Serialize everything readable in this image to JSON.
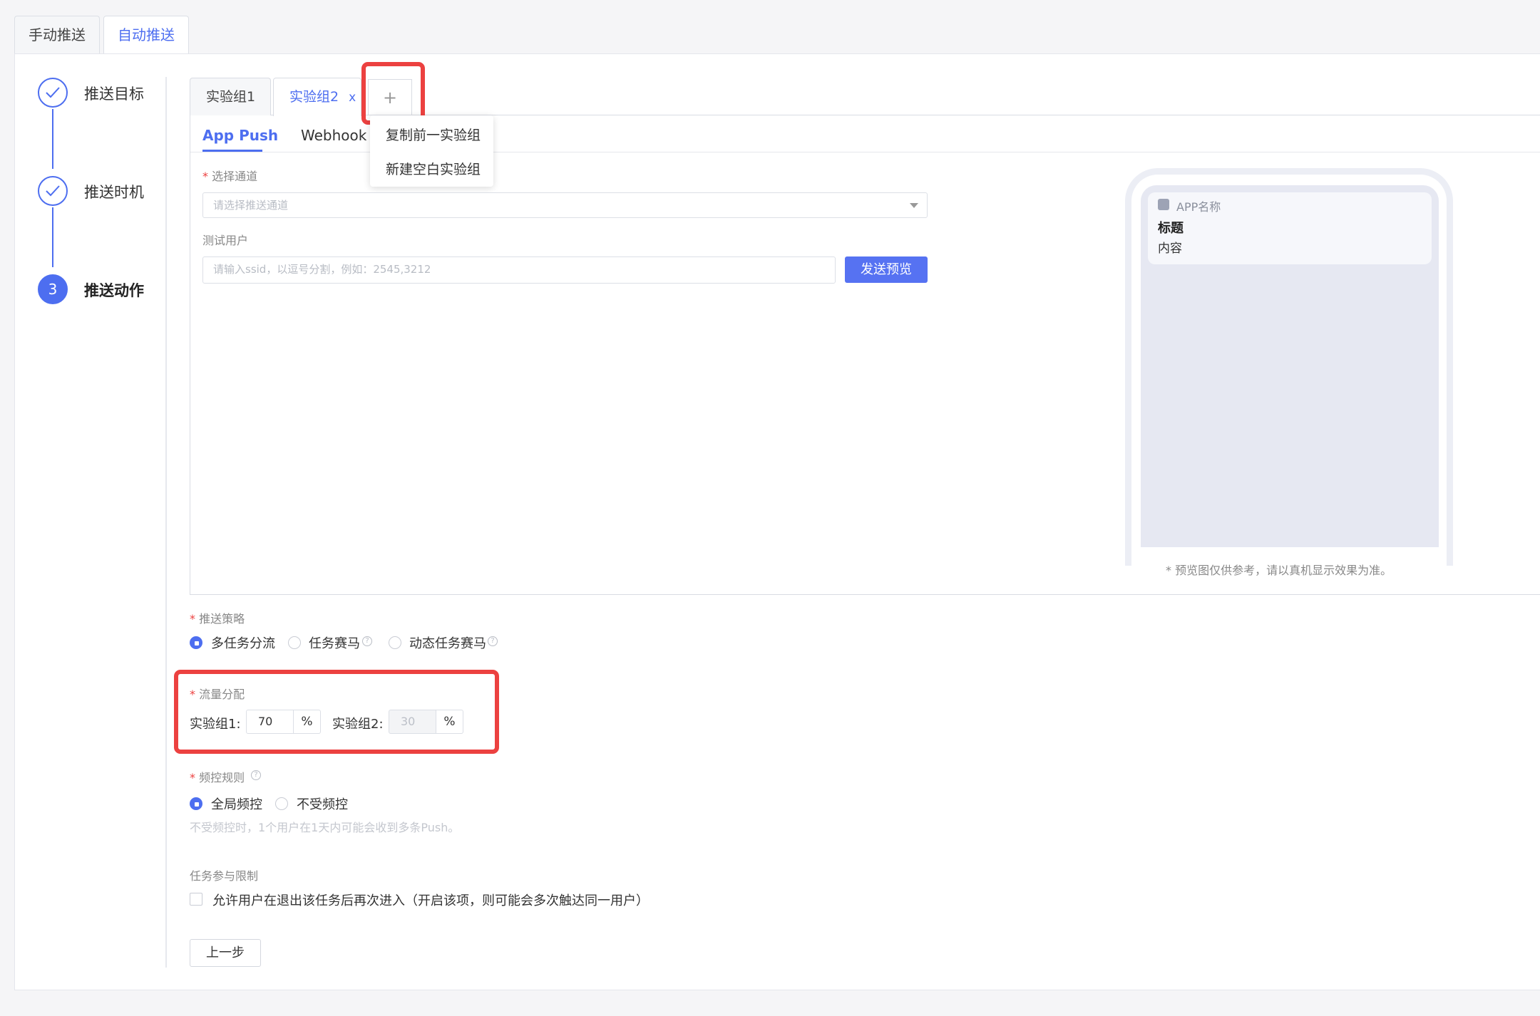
{
  "top_tabs": [
    "手动推送",
    "自动推送"
  ],
  "steps": [
    {
      "label": "推送目标",
      "state": "done"
    },
    {
      "label": "推送时机",
      "state": "done"
    },
    {
      "label": "推送动作",
      "state": "current",
      "number": "3"
    }
  ],
  "experiment_tabs": {
    "tabs": [
      "实验组1",
      "实验组2"
    ],
    "close_glyph": "x",
    "add_glyph": "+",
    "dropdown": [
      "复制前一实验组",
      "新建空白实验组"
    ]
  },
  "channel_tabs": [
    "App Push",
    "Webhook"
  ],
  "form": {
    "channel_label": "选择通道",
    "channel_placeholder": "请选择推送通道",
    "test_user_label": "测试用户",
    "test_user_placeholder": "请输入ssid，以逗号分割，例如：2545,3212",
    "send_preview_button": "发送预览",
    "required_mark": "*"
  },
  "preview": {
    "app_name": "APP名称",
    "title": "标题",
    "content": "内容",
    "note": "* 预览图仅供参考，请以真机显示效果为准。"
  },
  "strategy": {
    "label": "推送策略",
    "options": [
      "多任务分流",
      "任务赛马",
      "动态任务赛马"
    ],
    "selected": "多任务分流",
    "help_glyph": "?"
  },
  "traffic": {
    "label": "流量分配",
    "group1_label": "实验组1:",
    "group1_value": "70",
    "group2_label": "实验组2:",
    "group2_value": "30",
    "unit": "%"
  },
  "frequency": {
    "label": "频控规则",
    "options": [
      "全局频控",
      "不受频控"
    ],
    "selected": "全局频控",
    "hint": "不受频控时，1个用户在1天内可能会收到多条Push。"
  },
  "participation": {
    "label": "任务参与限制",
    "checkbox_label": "允许用户在退出该任务后再次进入（开启该项，则可能会多次触达同一用户）",
    "checked": false
  },
  "prev_button": "上一步",
  "colors": {
    "accent": "#4d6ef0",
    "highlight": "#ec4140"
  }
}
